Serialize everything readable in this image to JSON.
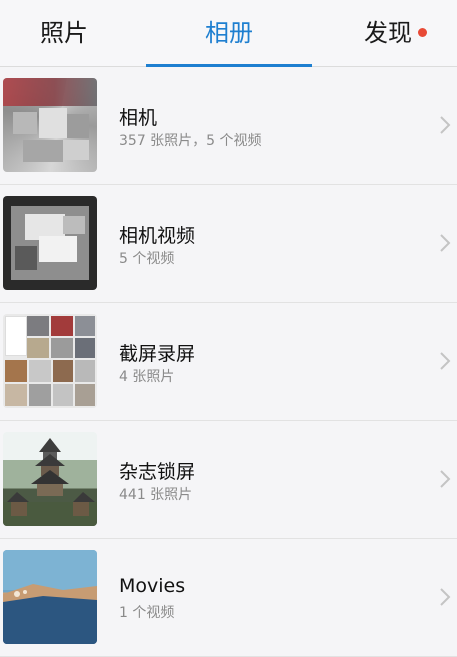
{
  "tabs": {
    "photos": "照片",
    "albums": "相册",
    "discover": "发现"
  },
  "colors": {
    "accent": "#1e7fd0",
    "notification_dot": "#e84a36"
  },
  "albums": [
    {
      "name": "相机",
      "count": "357 张照片，5 个视频"
    },
    {
      "name": "相机视频",
      "count": "5 个视频"
    },
    {
      "name": "截屏录屏",
      "count": "4 张照片"
    },
    {
      "name": "杂志锁屏",
      "count": "441 张照片"
    },
    {
      "name": "Movies",
      "count": "1 个视频"
    }
  ]
}
